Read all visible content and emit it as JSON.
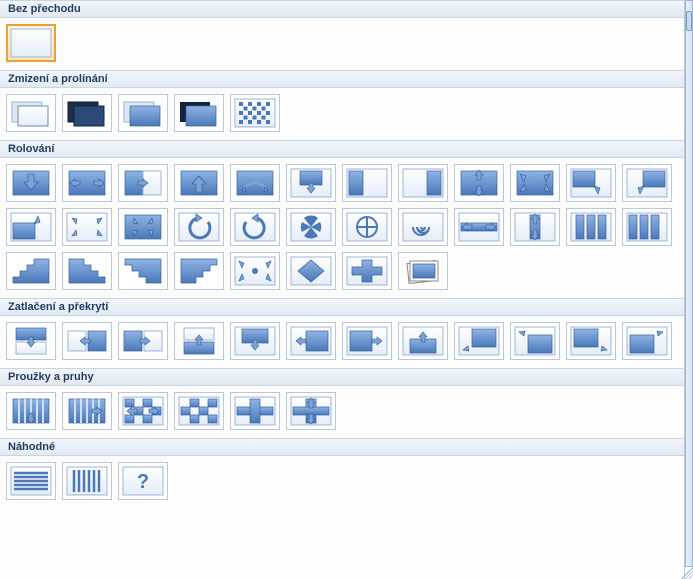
{
  "groups": [
    {
      "key": "no_transition",
      "label": "Bez přechodu",
      "items": [
        {
          "name": "transition-none",
          "icon": "plain",
          "selected": true
        }
      ]
    },
    {
      "key": "fade",
      "label": "Zmizení a prolínání",
      "items": [
        {
          "name": "fade-smooth",
          "icon": "stack-light"
        },
        {
          "name": "fade-through-black",
          "icon": "stack-dark"
        },
        {
          "name": "cut",
          "icon": "stack-front"
        },
        {
          "name": "cut-through-black",
          "icon": "stack-front-dark"
        },
        {
          "name": "dissolve",
          "icon": "checker-box"
        }
      ]
    },
    {
      "key": "roll",
      "label": "Rolování",
      "items": [
        {
          "name": "roll-down",
          "icon": "arrow-down"
        },
        {
          "name": "roll-lr",
          "icon": "arrows-lr"
        },
        {
          "name": "roll-right",
          "icon": "arrow-right-split"
        },
        {
          "name": "roll-up",
          "icon": "arrow-up"
        },
        {
          "name": "wheel-cw",
          "icon": "wheel-2"
        },
        {
          "name": "box-down",
          "icon": "box-arrow-down"
        },
        {
          "name": "slide-left",
          "icon": "side-left"
        },
        {
          "name": "slide-right",
          "icon": "side-right"
        },
        {
          "name": "arrows-ud",
          "icon": "arrows-ud"
        },
        {
          "name": "arrows-diag",
          "icon": "arrows-diag"
        },
        {
          "name": "corner-tl",
          "icon": "corner-tl"
        },
        {
          "name": "corner-tr",
          "icon": "corner-tr"
        },
        {
          "name": "corner-bl",
          "icon": "corner-bl"
        },
        {
          "name": "expand-out",
          "icon": "arrows-out"
        },
        {
          "name": "expand-in",
          "icon": "arrows-in"
        },
        {
          "name": "rotate-left",
          "icon": "rotate-left"
        },
        {
          "name": "rotate-right",
          "icon": "rotate-right"
        },
        {
          "name": "pinwheel",
          "icon": "pinwheel"
        },
        {
          "name": "wheel-4",
          "icon": "wheel-4"
        },
        {
          "name": "spiral",
          "icon": "spiral"
        },
        {
          "name": "bar-horiz",
          "icon": "bar-horiz"
        },
        {
          "name": "bar-vert",
          "icon": "bar-vert"
        },
        {
          "name": "vblinds",
          "icon": "vblinds"
        },
        {
          "name": "vblinds-2",
          "icon": "vblinds-2"
        },
        {
          "name": "stairs-1",
          "icon": "stairs-1"
        },
        {
          "name": "stairs-2",
          "icon": "stairs-2"
        },
        {
          "name": "stairs-3",
          "icon": "stairs-3"
        },
        {
          "name": "stairs-4",
          "icon": "stairs-4"
        },
        {
          "name": "arrows-corners",
          "icon": "arrows-corners"
        },
        {
          "name": "diamond",
          "icon": "diamond"
        },
        {
          "name": "plus",
          "icon": "plus"
        },
        {
          "name": "newsflash",
          "icon": "photo"
        }
      ]
    },
    {
      "key": "push",
      "label": "Zatlačení a překrytí",
      "items": [
        {
          "name": "push-down",
          "icon": "push-down"
        },
        {
          "name": "push-left",
          "icon": "push-left"
        },
        {
          "name": "push-right",
          "icon": "push-right"
        },
        {
          "name": "push-up",
          "icon": "push-up"
        },
        {
          "name": "cover-down",
          "icon": "cover-down"
        },
        {
          "name": "cover-left",
          "icon": "cover-left"
        },
        {
          "name": "cover-right",
          "icon": "cover-right"
        },
        {
          "name": "cover-up",
          "icon": "cover-up"
        },
        {
          "name": "cover-ld",
          "icon": "cover-ld"
        },
        {
          "name": "cover-lu",
          "icon": "cover-lu"
        },
        {
          "name": "cover-rd",
          "icon": "cover-rd"
        },
        {
          "name": "cover-ru",
          "icon": "cover-ru"
        }
      ]
    },
    {
      "key": "stripes",
      "label": "Proužky a pruhy",
      "items": [
        {
          "name": "stripes-down",
          "icon": "stripes-down"
        },
        {
          "name": "stripes-right",
          "icon": "stripes-right"
        },
        {
          "name": "comb-h",
          "icon": "comb-h"
        },
        {
          "name": "comb-v",
          "icon": "comb-v"
        },
        {
          "name": "cross-h",
          "icon": "cross-h"
        },
        {
          "name": "cross-v",
          "icon": "cross-v"
        }
      ]
    },
    {
      "key": "random",
      "label": "Náhodné",
      "items": [
        {
          "name": "random-bars-h",
          "icon": "hlines"
        },
        {
          "name": "random-bars-v",
          "icon": "vlines"
        },
        {
          "name": "random",
          "icon": "question"
        }
      ]
    }
  ]
}
